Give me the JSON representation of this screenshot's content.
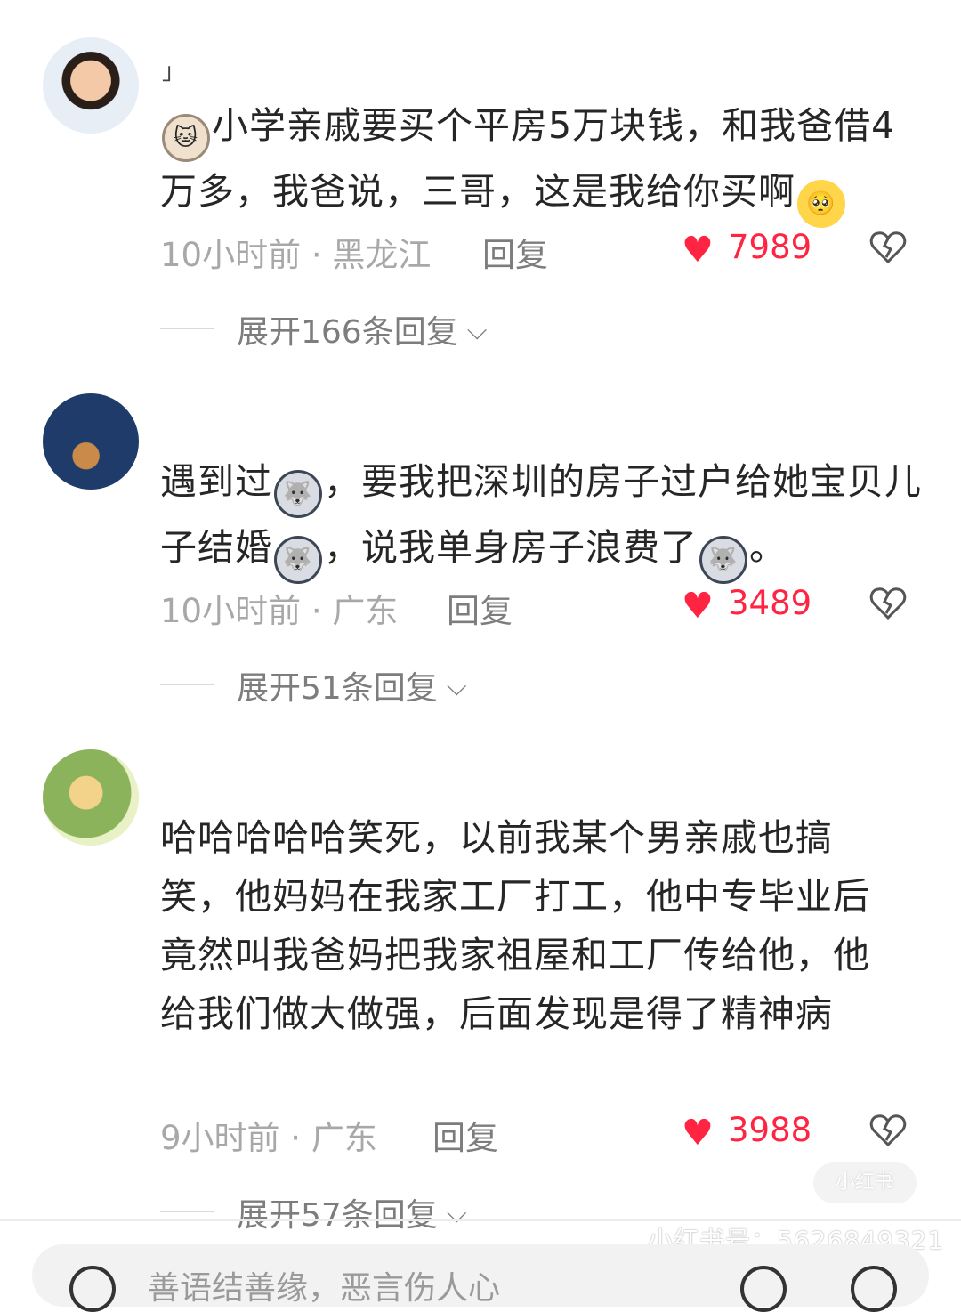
{
  "comments": [
    {
      "prefix": "」",
      "text_parts": [
        "小学亲戚要买个平房5万块钱，和我爸借4万多，我爸说，三哥，这是我给你买啊"
      ],
      "time": "10小时前 · 黑龙江",
      "reply": "回复",
      "likes": "7989",
      "expand": "展开166条回复"
    },
    {
      "text_parts": [
        "遇到过",
        "，要我把深圳的房子过户给她宝贝儿子结婚",
        "，说我单身房子浪费了",
        "。"
      ],
      "time": "10小时前 · 广东",
      "reply": "回复",
      "likes": "3489",
      "expand": "展开51条回复"
    },
    {
      "text": "哈哈哈哈哈笑死，以前我某个男亲戚也搞笑，他妈妈在我家工厂打工，他中专毕业后竟然叫我爸妈把我家祖屋和工厂传给他，他给我们做大做强，后面发现是得了精神病",
      "time": "9小时前 · 广东",
      "reply": "回复",
      "likes": "3988",
      "expand": "展开57条回复"
    }
  ],
  "watermark": {
    "logo": "小红书",
    "id_text": "小红书号：5626849321"
  },
  "bottom_bar": {
    "placeholder": "善语结善缘，恶言伤人心"
  },
  "icons": {
    "like": "heart-icon",
    "dislike": "broken-heart-icon",
    "expand": "chevron-down-icon"
  },
  "colors": {
    "like": "#ff2442",
    "meta": "#a8a8a8"
  }
}
